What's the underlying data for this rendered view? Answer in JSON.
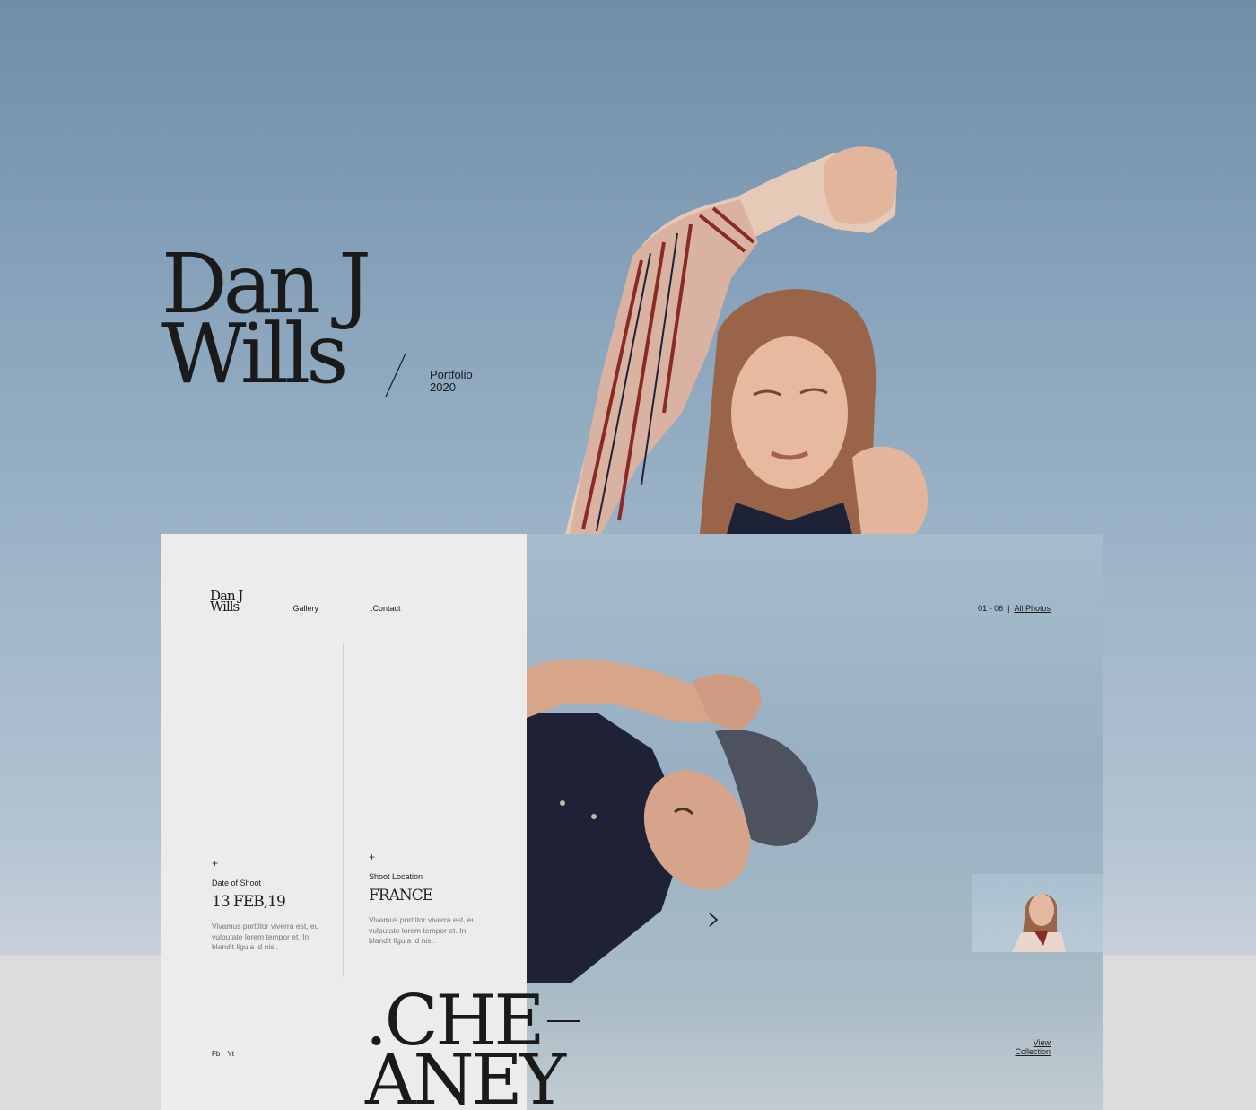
{
  "hero": {
    "title_line1": "Dan J",
    "title_line2": "Wills",
    "subtitle_line1": "Portfolio",
    "subtitle_line2": "2020"
  },
  "mockup": {
    "logo_line1": "Dan J",
    "logo_line2": "Wills",
    "nav": {
      "gallery": ".Gallery",
      "contact": ".Contact"
    },
    "counter": {
      "range": "01 - 06",
      "separator": "|",
      "all_photos": "All Photos"
    },
    "date_block": {
      "icon": "plus-icon",
      "label": "Date of Shoot",
      "value": "13 FEB,19",
      "description": "Vivamus porttitor viverra est, eu vulputate lorem tempor et. In blandit ligula id nisl."
    },
    "location_block": {
      "icon": "plus-icon",
      "label": "Shoot Location",
      "value": "FRANCE",
      "description": "Vivamus porttitor viverra est, eu vulputate lorem tempor et. In blandit ligula id nisl."
    },
    "social": {
      "fb": "Fb",
      "yt": "Yt"
    },
    "big_word_line1": ".CHE",
    "big_word_line2": "ANEY",
    "view_collection_line1": "View",
    "view_collection_line2": "Collection",
    "next_icon": "chevron-right-icon"
  },
  "colors": {
    "sky_top": "#6f8ea8",
    "sky_bottom": "#c8d1da",
    "panel_left": "#ececec",
    "text_dark": "#1a1a1a",
    "shirt_red": "#8a2a24",
    "shirt_navy": "#1e2236"
  }
}
